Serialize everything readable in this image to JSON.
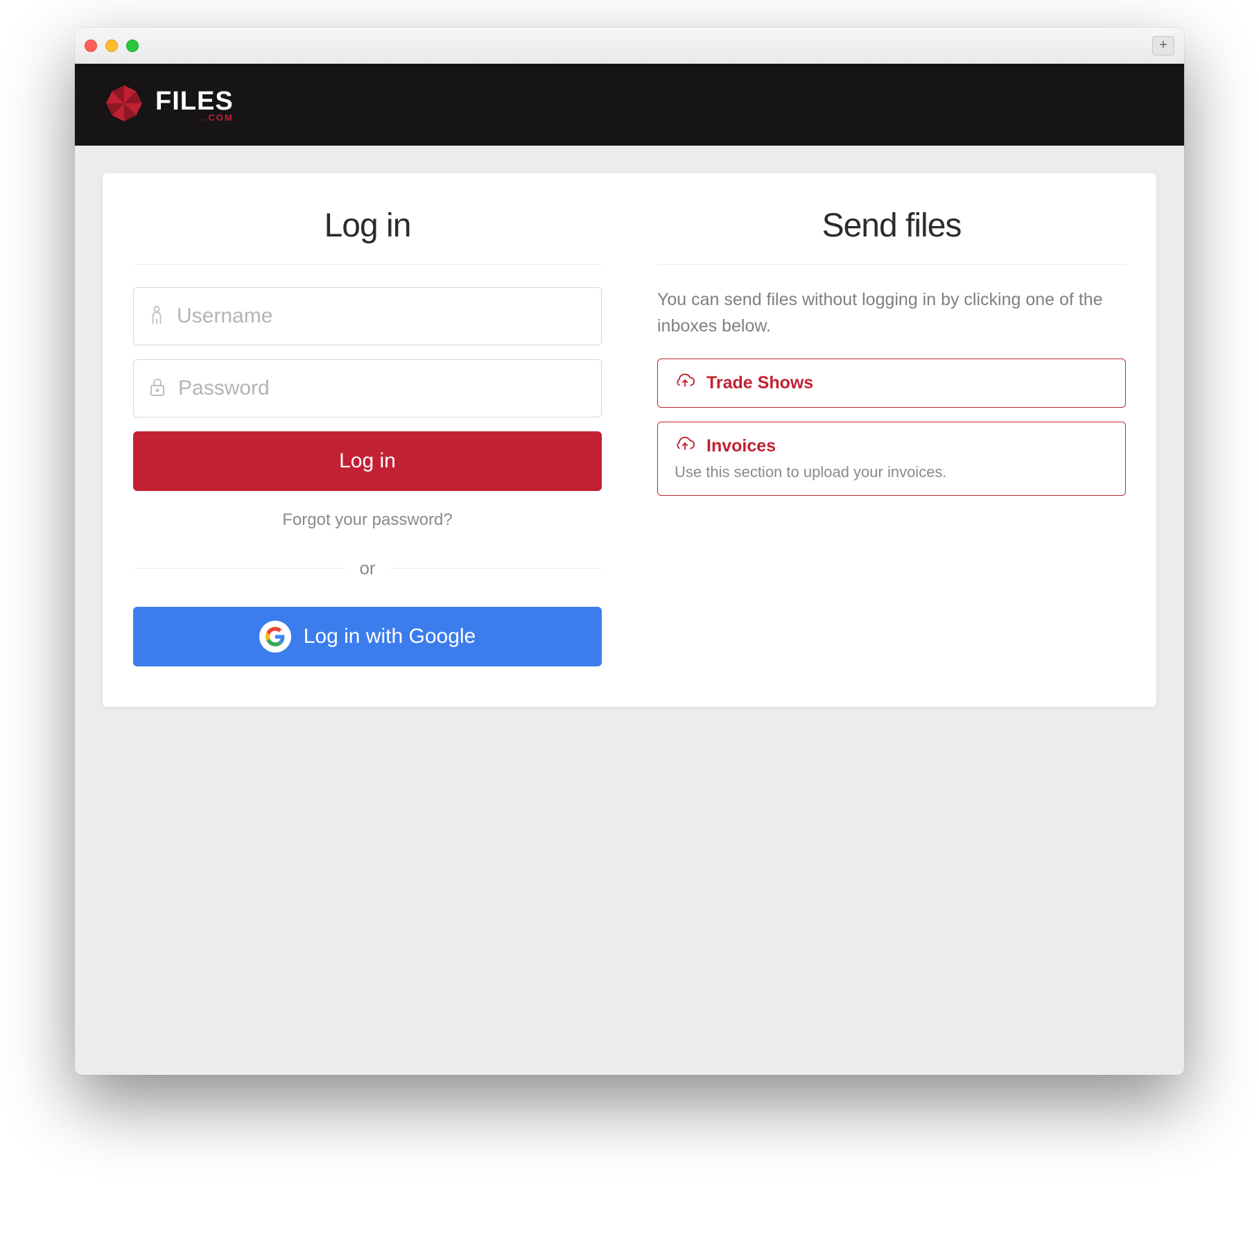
{
  "brand": {
    "name": "FILES",
    "suffix": ".COM"
  },
  "colors": {
    "accent": "#c22133",
    "google": "#3b7ded"
  },
  "login": {
    "title": "Log in",
    "username_placeholder": "Username",
    "password_placeholder": "Password",
    "submit_label": "Log in",
    "forgot_label": "Forgot your password?",
    "or_label": "or",
    "google_label": "Log in with Google"
  },
  "send": {
    "title": "Send files",
    "description": "You can send files without logging in by clicking one of the inboxes below.",
    "inboxes": [
      {
        "title": "Trade Shows",
        "description": ""
      },
      {
        "title": "Invoices",
        "description": "Use this section to upload your invoices."
      }
    ]
  }
}
